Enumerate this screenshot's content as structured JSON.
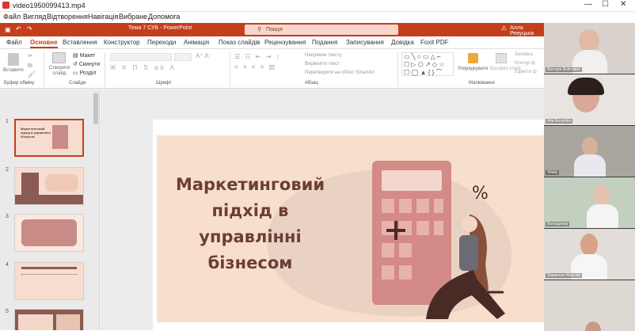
{
  "player": {
    "title": "video1950099413.mp4",
    "menu": [
      "Файл",
      "Вигляд",
      "Відтворення",
      "Навігація",
      "Вибране",
      "Допомога"
    ],
    "minimize": "—",
    "maximize": "☐",
    "close": "✕"
  },
  "powerpoint": {
    "doc_title": "Тема 7 СУБ  -  PowerPoint",
    "search_placeholder": "Пошук",
    "user": "Алла Ревуцька",
    "tabs": [
      "Файл",
      "Основне",
      "Вставлення",
      "Конструктор",
      "Переходи",
      "Анімація",
      "Показ слайдів",
      "Рецензування",
      "Подання",
      "Записування",
      "Довідка",
      "Foxit PDF"
    ],
    "active_tab": "Основне",
    "ribbon": {
      "paste": "Вставити",
      "clipboard": "Буфер обміну",
      "new_slide": "Створити слайд",
      "layout": "Макет",
      "reset": "Скинути",
      "section": "Розділ",
      "slides": "Слайди",
      "font": "Шрифт",
      "text_direction": "Напрямок тексту",
      "align_text": "Вирівняти текст",
      "smartart": "Перетворити на об'єкт SmartArt",
      "paragraph": "Абзац",
      "arrange": "Упорядкувати",
      "quick_styles": "Експрес-стилі",
      "fill": "Заливка",
      "outline": "Контур ф",
      "effects": "Ефекти ф",
      "drawing": "Малювання"
    },
    "slides": [
      {
        "number": "1",
        "title": "Маркетинговий підхід в управлінні бізнесом"
      },
      {
        "number": "2"
      },
      {
        "number": "3"
      },
      {
        "number": "4"
      },
      {
        "number": "5"
      }
    ],
    "current_slide": {
      "title": "Маркетинговий підхід в управлінні бізнесом",
      "title_lines": [
        "Маркетинговий",
        "підхід в управлінні",
        "бізнесом"
      ]
    }
  },
  "participants": [
    {
      "name": "Вікторія Войтович"
    },
    {
      "name": "Alla Revytska"
    },
    {
      "name": "Vitaliy"
    },
    {
      "name": "Володимир"
    },
    {
      "name": "Якименко Максим"
    },
    {
      "name": ""
    }
  ],
  "colors": {
    "accent": "#c43e1c",
    "slide_bg": "#f8dfcc",
    "title": "#6b3f34",
    "calculator": "#d48a86"
  }
}
